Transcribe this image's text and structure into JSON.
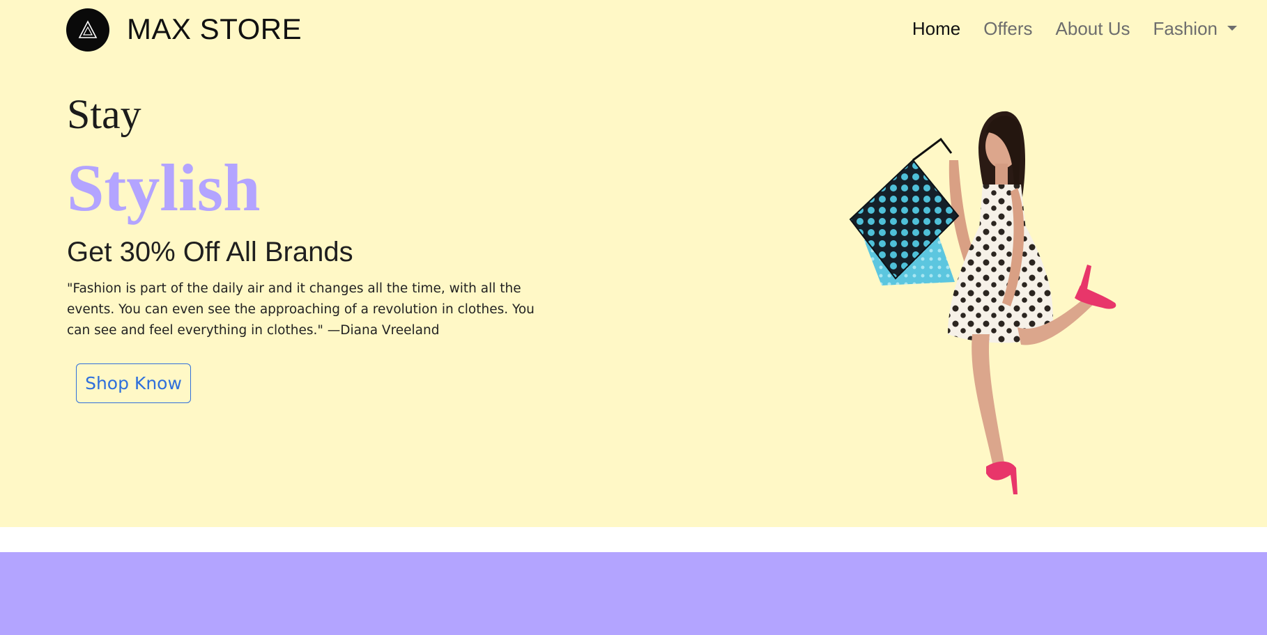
{
  "nav": {
    "brand": "MAX STORE",
    "links": [
      {
        "label": "Home",
        "active": true
      },
      {
        "label": "Offers",
        "active": false
      },
      {
        "label": "About Us",
        "active": false
      },
      {
        "label": "Fashion",
        "active": false,
        "dropdown": true
      }
    ]
  },
  "hero": {
    "line1": "Stay",
    "line2": "Stylish",
    "offer": "Get 30% Off All Brands",
    "quote": "\"Fashion is part of the daily air and it changes all the time, with all the events. You can even see the approaching of a revolution in clothes. You can see and feel everything in clothes.\" —Diana Vreeland",
    "button": "Shop Know",
    "image_icon": "shopping-woman-illustration"
  },
  "colors": {
    "hero_bg": "#fff8c6",
    "accent": "#b3a4ff",
    "button": "#2f6fdb",
    "band": "#b3a4ff"
  }
}
